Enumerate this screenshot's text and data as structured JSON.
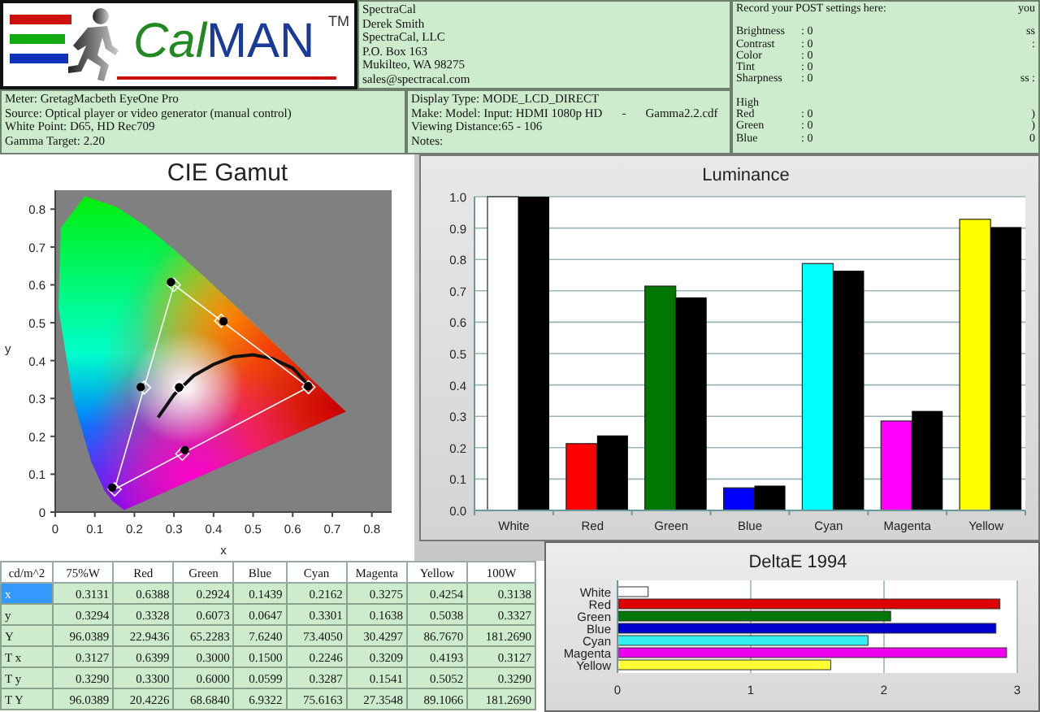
{
  "logo": {
    "brand_part_1": "Cal",
    "brand_part_2": "MAN",
    "trademark": "TM"
  },
  "company": [
    "SpectraCal",
    "Derek Smith",
    "SpectraCal, LLC",
    "P.O. Box 163",
    "Mukilteo, WA 98275",
    "sales@spectracal.com"
  ],
  "meter": [
    "Meter: GretagMacbeth EyeOne Pro",
    "Source: Optical player or video generator (manual control)",
    "White Point: D65, HD Rec709",
    "Gamma Target: 2.20"
  ],
  "display": [
    [
      "Display Type: MODE_LCD_DIRECT"
    ],
    [
      "Make: Model: Input: HDMI 1080p HD",
      "-",
      "Gamma2.2.cdf"
    ],
    [
      "Viewing Distance:65 - 106"
    ],
    [
      "Notes:"
    ]
  ],
  "post_settings": {
    "title": "Record your POST settings here:",
    "title_edge": "you",
    "groups": [
      [
        {
          "label": "Brightness",
          "value": ": 0",
          "edge": "ss"
        },
        {
          "label": "Contrast",
          "value": ": 0",
          "edge": ":"
        },
        {
          "label": "Color",
          "value": ": 0"
        },
        {
          "label": "Tint",
          "value": ": 0"
        },
        {
          "label": "Sharpness",
          "value": ": 0",
          "edge": "ss :"
        }
      ],
      [
        {
          "label": "High"
        },
        {
          "label": "Red",
          "value": ": 0",
          "edge": ")"
        },
        {
          "label": "Green",
          "value": ": 0",
          "edge": ")"
        },
        {
          "label": "Blue",
          "value": ": 0",
          "edge": "0"
        }
      ]
    ]
  },
  "cie": {
    "chart_data": {
      "type": "scatter",
      "title": "CIE Gamut",
      "xlabel": "x",
      "ylabel": "y",
      "xlim": [
        0,
        0.85
      ],
      "ylim": [
        0,
        0.85
      ],
      "xticks": [
        {
          "value": 0,
          "label": "0"
        },
        0.1,
        0.2,
        0.3,
        0.4,
        0.5,
        0.6,
        0.7,
        0.8
      ],
      "yticks": [
        {
          "value": 0,
          "label": "0"
        },
        0.1,
        0.2,
        0.3,
        0.4,
        0.5,
        0.6,
        0.7,
        0.8
      ],
      "series": [
        {
          "type": "line",
          "color": "#111111",
          "x": [
            0.26,
            0.3,
            0.35,
            0.4,
            0.45,
            0.5,
            0.55,
            0.6,
            0.64
          ],
          "values": [
            0.25,
            0.31,
            0.36,
            0.39,
            0.41,
            0.415,
            0.405,
            0.38,
            0.335
          ]
        },
        {
          "type": "line",
          "color": "#ffffff",
          "x": [
            0.3,
            0.6399
          ],
          "values": [
            0.6,
            0.33
          ]
        },
        {
          "type": "line",
          "color": "#ffffff",
          "x": [
            0.15,
            0.3
          ],
          "values": [
            0.0599,
            0.6
          ]
        },
        {
          "type": "line",
          "color": "#ffffff",
          "x": [
            0.15,
            0.6399
          ],
          "values": [
            0.0599,
            0.33
          ]
        },
        {
          "type": "scatter",
          "marker": "diamond",
          "color": "#ffffff",
          "x": [
            0.3127,
            0.6399,
            0.3,
            0.15,
            0.2246,
            0.3209,
            0.4193
          ],
          "values": [
            0.329,
            0.33,
            0.6,
            0.0599,
            0.3287,
            0.1541,
            0.5052
          ]
        },
        {
          "type": "scatter",
          "marker": "circle",
          "color": "#000000",
          "x": [
            0.3131,
            0.6388,
            0.2924,
            0.1439,
            0.2162,
            0.3275,
            0.4254
          ],
          "values": [
            0.3294,
            0.3328,
            0.6073,
            0.0647,
            0.3301,
            0.1638,
            0.5038
          ]
        }
      ]
    }
  },
  "luminance": {
    "chart_data": {
      "type": "bar",
      "title": "Luminance",
      "categories": [
        "White",
        "Red",
        "Green",
        "Blue",
        "Cyan",
        "Magenta",
        "Yellow"
      ],
      "ylim": [
        0,
        1
      ],
      "grid": true,
      "yticks": [
        {
          "value": 0,
          "label": "0.0"
        },
        0.1,
        0.2,
        0.3,
        0.4,
        0.5,
        0.6,
        0.7,
        0.8,
        0.9,
        {
          "value": 1,
          "label": "1.0"
        }
      ],
      "series": [
        {
          "colors": [
            "#ffffff",
            "#ff0000",
            "#007700",
            "#0000ff",
            "#00ffff",
            "#ff00ff",
            "#ffff00"
          ],
          "values": [
            1.0,
            0.213,
            0.715,
            0.072,
            0.787,
            0.285,
            0.928
          ]
        },
        {
          "color": "#000000",
          "values": [
            1.0,
            0.239,
            0.679,
            0.079,
            0.764,
            0.317,
            0.903
          ]
        }
      ]
    }
  },
  "deltae": {
    "chart_data": {
      "type": "bar",
      "orientation": "horizontal",
      "title": "DeltaE 1994",
      "categories": [
        "White",
        "Red",
        "Green",
        "Blue",
        "Cyan",
        "Magenta",
        "Yellow"
      ],
      "xlim": [
        0,
        3
      ],
      "xticks": [
        0,
        1,
        2,
        3
      ],
      "grid": true,
      "series": [
        {
          "colors": [
            "#ffffff",
            "#dd0000",
            "#007700",
            "#0000cc",
            "#33eeee",
            "#ee00ee",
            "#ffff33"
          ],
          "values": [
            0.23,
            2.87,
            2.05,
            2.84,
            1.88,
            2.92,
            1.6
          ]
        }
      ]
    }
  },
  "table": {
    "columns": [
      "cd/m^2",
      "75%W",
      "Red",
      "Green",
      "Blue",
      "Cyan",
      "Magenta",
      "Yellow",
      "100W"
    ],
    "rows": [
      {
        "selected": true,
        "cells": [
          "x",
          "0.3131",
          "0.6388",
          "0.2924",
          "0.1439",
          "0.2162",
          "0.3275",
          "0.4254",
          "0.3138"
        ]
      },
      {
        "selected": false,
        "cells": [
          "y",
          "0.3294",
          "0.3328",
          "0.6073",
          "0.0647",
          "0.3301",
          "0.1638",
          "0.5038",
          "0.3327"
        ]
      },
      {
        "selected": false,
        "cells": [
          "Y",
          "96.0389",
          "22.9436",
          "65.2283",
          "7.6240",
          "73.4050",
          "30.4297",
          "86.7670",
          "181.2690"
        ]
      },
      {
        "selected": false,
        "cells": [
          "T x",
          "0.3127",
          "0.6399",
          "0.3000",
          "0.1500",
          "0.2246",
          "0.3209",
          "0.4193",
          "0.3127"
        ]
      },
      {
        "selected": false,
        "cells": [
          "T y",
          "0.3290",
          "0.3300",
          "0.6000",
          "0.0599",
          "0.3287",
          "0.1541",
          "0.5052",
          "0.3290"
        ]
      },
      {
        "selected": false,
        "cells": [
          "T Y",
          "96.0389",
          "20.4226",
          "68.6840",
          "6.9322",
          "75.6163",
          "27.3548",
          "89.1066",
          "181.2690"
        ]
      }
    ]
  }
}
